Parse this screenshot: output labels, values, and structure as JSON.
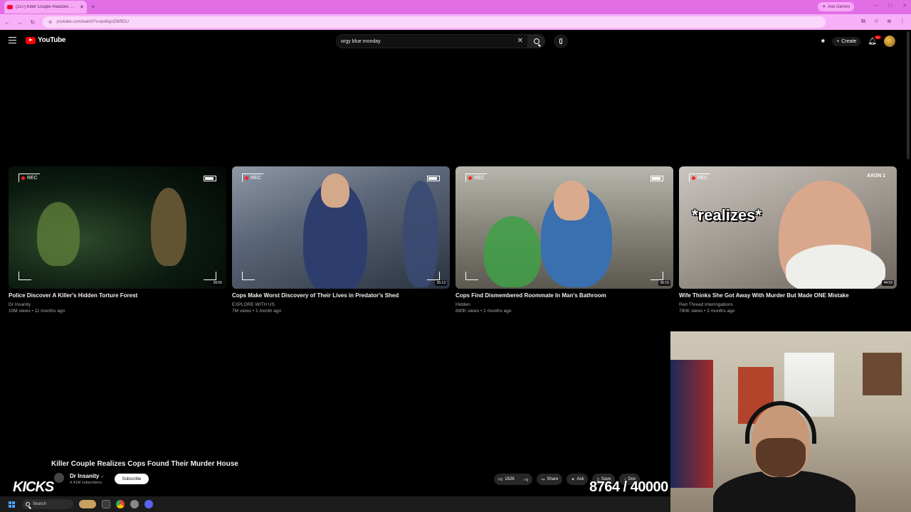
{
  "browser": {
    "tab_title": "(157) Killer Couple Realizes Cop",
    "tab_close": "✕",
    "new_tab": "+",
    "gemini_label": "Ask Gemini",
    "url": "youtube.com/watch?v=po8sjol2W9DU",
    "back": "←",
    "forward": "→",
    "reload": "↻",
    "window_controls": [
      "—",
      "☐",
      "✕"
    ]
  },
  "youtube": {
    "logo_text": "YouTube",
    "search_value": "orgy blue monday",
    "clear_icon": "✕",
    "create_label": "Create",
    "notif_count": "9+"
  },
  "videos": [
    {
      "title": "Police Discover A Killer's Hidden Torture Forest",
      "channel": "Dr Insanity",
      "stats": "10M views • 11 months ago",
      "duration": "28:06",
      "rec": "REC"
    },
    {
      "title": "Cops Make Worst Discovery of Their Lives in Predator's Shed",
      "channel": "EXPLORE WITH US",
      "stats": "7M views • 1 month ago",
      "duration": "35:13",
      "rec": "REC"
    },
    {
      "title": "Cops Find Dismembered Roommate In Man's Bathroom",
      "channel": "Hidden",
      "stats": "890K views • 2 months ago",
      "duration": "36:15",
      "rec": "REC"
    },
    {
      "title": "Wife Thinks She Got Away With Murder But Made ONE Mistake",
      "channel": "Red Thread Interrogations",
      "stats": "780K views • 3 months ago",
      "duration": "44:59",
      "rec": "REC",
      "overlay": "*realizes*",
      "badge": "AXON 1"
    }
  ],
  "current_video": {
    "title": "Killer Couple Realizes Cops Found Their Murder House",
    "channel": "Dr Insanity",
    "subscribers": "4.41M subscribers",
    "subscribe_label": "Subscribe",
    "likes": "162K",
    "share_label": "Share",
    "ask_label": "Ask",
    "save_label": "Save",
    "download_label": "Dov"
  },
  "stream_overlay": {
    "kicks": "KICKS",
    "counter": "8764 / 40000"
  },
  "taskbar": {
    "search_label": "Search"
  },
  "colors": {
    "browser_tab_bar": "#e26ee6",
    "youtube_red": "#ff0000",
    "background": "#000000"
  }
}
